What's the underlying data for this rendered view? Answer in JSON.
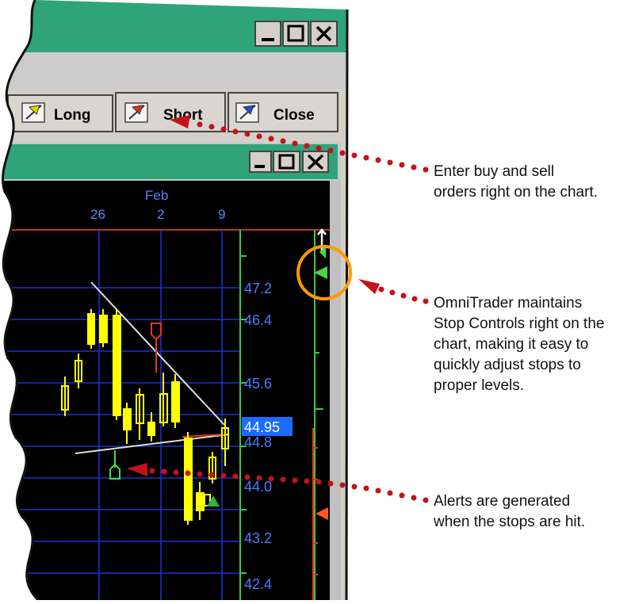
{
  "toolbar": {
    "buttons": [
      {
        "label": "Long",
        "icon": "flag-long-icon"
      },
      {
        "label": "Short",
        "icon": "flag-short-icon"
      },
      {
        "label": "Close",
        "icon": "flag-close-icon"
      }
    ]
  },
  "chart": {
    "date_labels": {
      "month": "Feb",
      "d1": "26",
      "d2": "2",
      "d3": "9"
    },
    "price_labels": [
      "47.2",
      "46.4",
      "45.6",
      "44.95",
      "44.8",
      "44.0",
      "43.2",
      "42.4"
    ],
    "current_price": "44.95"
  },
  "callouts": {
    "orders": {
      "line1": "Enter buy and sell",
      "line2": "orders right on the chart."
    },
    "stops": {
      "line1": "OmniTrader maintains",
      "line2": "Stop Controls right on the",
      "line3": "chart, making it easy to",
      "line4": "quickly adjust stops to",
      "line5": "proper levels."
    },
    "alerts": {
      "line1": "Alerts are generated",
      "line2": "when the stops are hit."
    }
  },
  "colors": {
    "title_bar": "#2fa37a",
    "chart_bg": "#000000",
    "grid": "#1f2fd0",
    "candle": "#ffff00",
    "price_text": "#4a7bff",
    "highlight": "#1a6cff",
    "callout_dots": "#c4121a",
    "stop_circle": "#ff9a00",
    "stop_marker": "#46d946"
  }
}
